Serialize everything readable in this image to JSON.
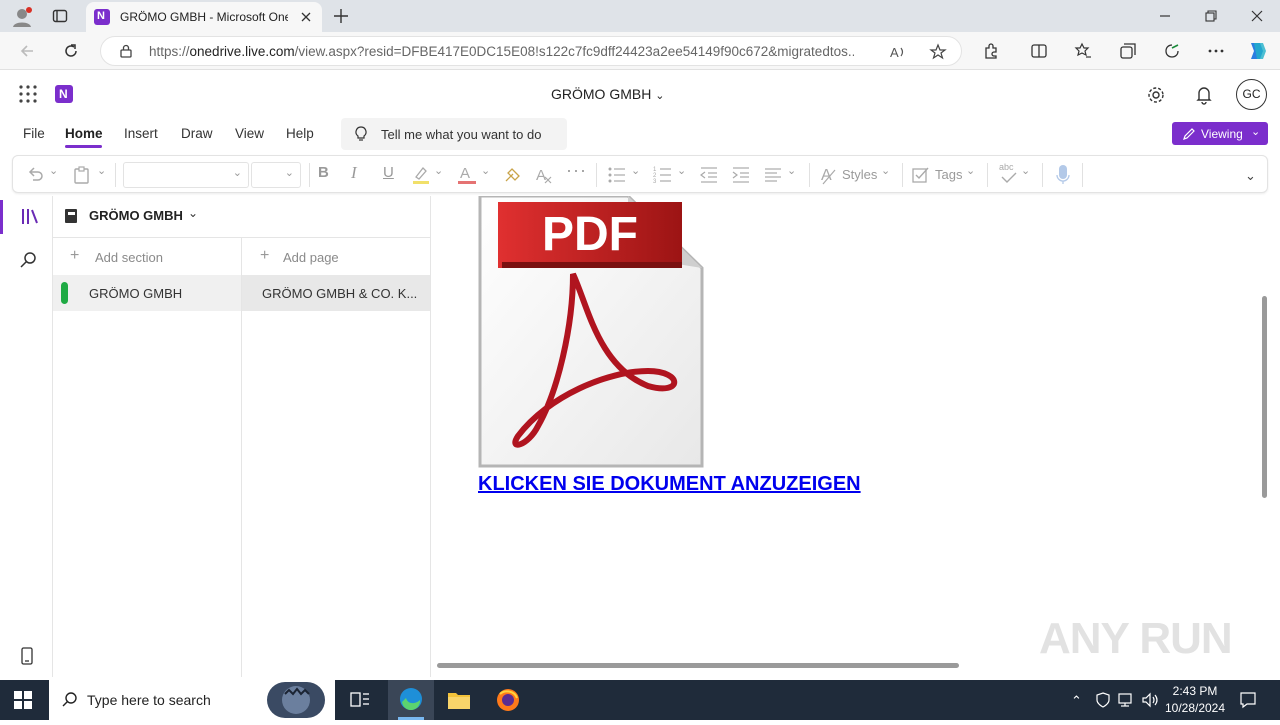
{
  "browser": {
    "tab_title": "GRÖMO GMBH - Microsoft OneNote",
    "url_prefix": "https://",
    "url_host": "onedrive.live.com",
    "url_rest": "/view.aspx?resid=DFBE417E0DC15E08!s122c7fc9dff24423a2ee54149f90c672&migratedtos..."
  },
  "app": {
    "notebook_title": "GRÖMO GMBH",
    "avatar_initials": "GC",
    "menu": [
      "File",
      "Home",
      "Insert",
      "Draw",
      "View",
      "Help"
    ],
    "active_menu": "Home",
    "tell_me": "Tell me what you want to do",
    "viewing_label": "Viewing"
  },
  "ribbon": {
    "styles_label": "Styles",
    "tags_label": "Tags",
    "spell_label": "abc"
  },
  "nav": {
    "notebook_name": "GRÖMO GMBH",
    "add_section": "Add section",
    "add_page": "Add page",
    "sections": [
      "GRÖMO GMBH"
    ],
    "pages": [
      "GRÖMO GMBH & CO. K..."
    ]
  },
  "content": {
    "pdf_badge": "PDF",
    "link_text": "KLICKEN SIE DOKUMENT ANZUZEIGEN"
  },
  "watermark": "ANY RUN",
  "taskbar": {
    "search_placeholder": "Type here to search",
    "time": "2:43 PM",
    "date": "10/28/2024"
  },
  "colors": {
    "accent": "#7b2ecc",
    "link": "#0000ee",
    "section_color": "#1faa44"
  }
}
